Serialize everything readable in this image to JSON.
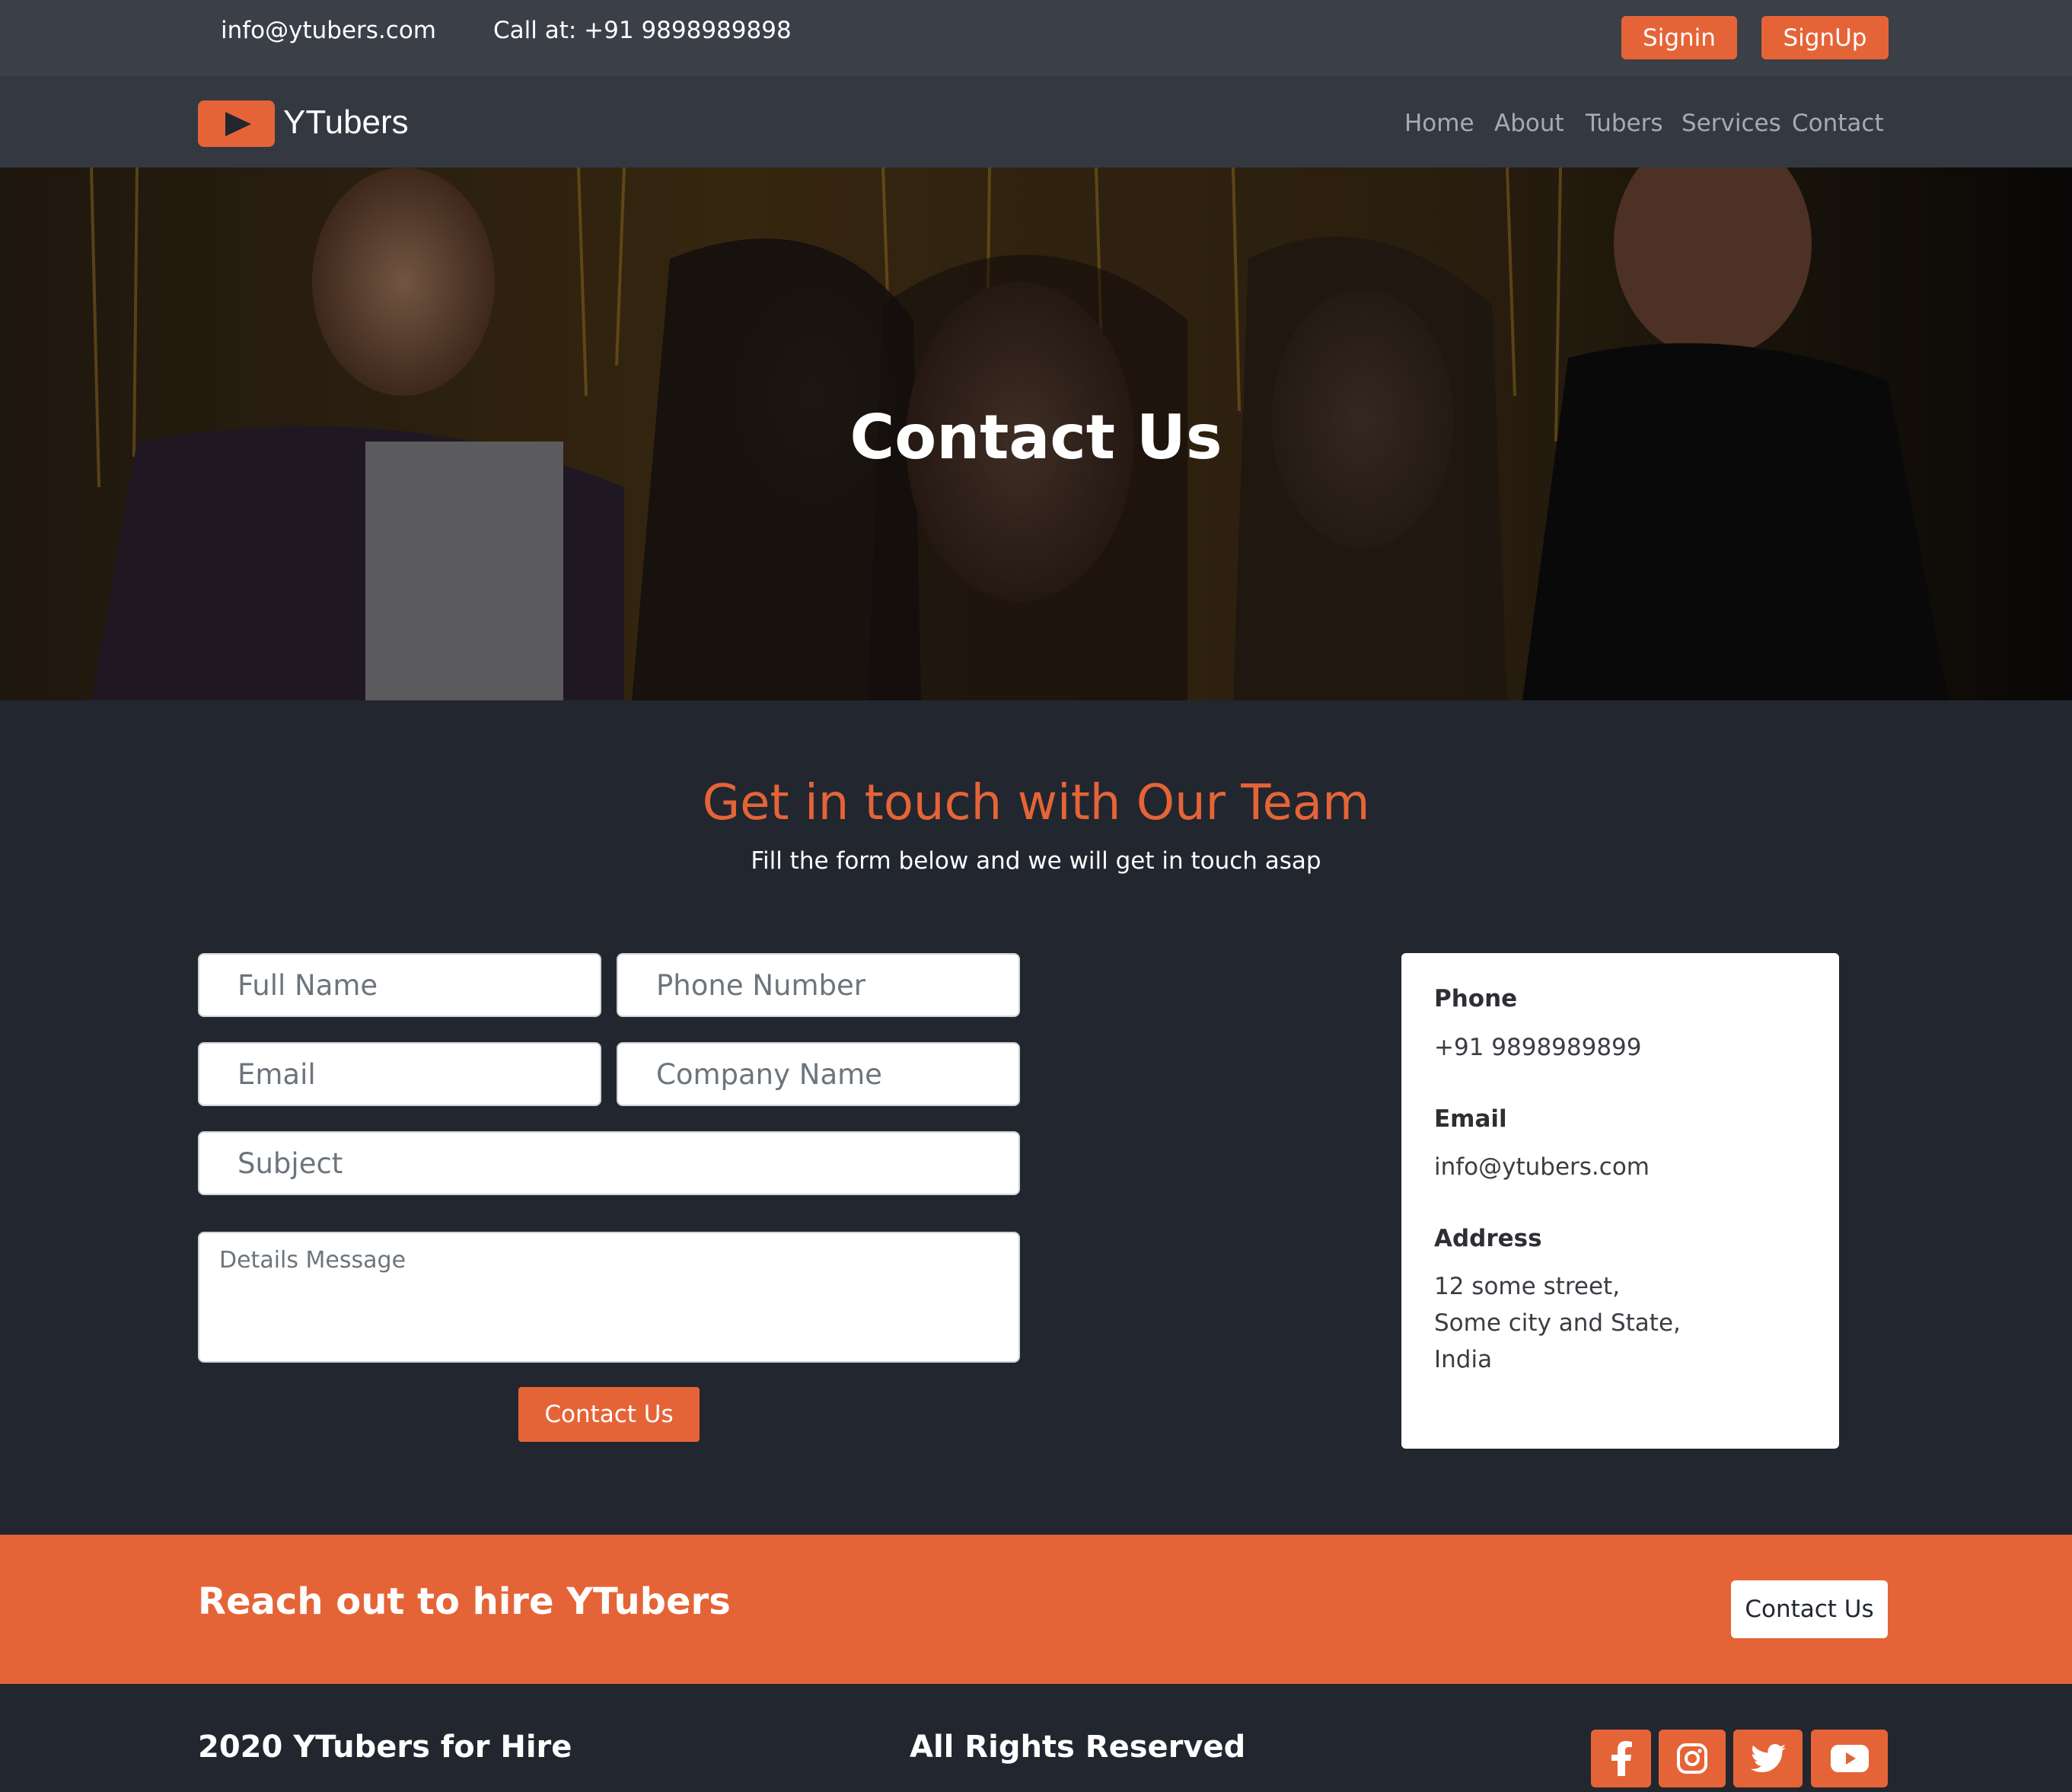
{
  "topbar": {
    "email": "info@ytubers.com",
    "phone": "Call at: +91 9898989898",
    "signin_label": "Signin",
    "signup_label": "SignUp"
  },
  "navbar": {
    "brand": "YTubers",
    "links": [
      "Home",
      "About",
      "Tubers",
      "Services",
      "Contact"
    ]
  },
  "hero": {
    "title": "Contact Us"
  },
  "contact": {
    "title": "Get in touch with Our Team",
    "subtitle": "Fill the form below and we will get in touch asap",
    "fields": {
      "full_name": "Full Name",
      "phone": "Phone Number",
      "email": "Email",
      "company": "Company Name",
      "subject": "Subject",
      "message": "Details Message"
    },
    "submit_label": "Contact Us"
  },
  "info_card": {
    "phone_label": "Phone",
    "phone_value": "+91 9898989899",
    "email_label": "Email",
    "email_value": "info@ytubers.com",
    "address_label": "Address",
    "address_lines": [
      "12 some street,",
      "Some city and State,",
      "India"
    ]
  },
  "cta": {
    "text": "Reach out to hire YTubers",
    "button_label": "Contact Us"
  },
  "footer": {
    "left": "2020 YTubers for Hire",
    "middle": "All Rights Reserved",
    "social_icons": [
      "facebook-icon",
      "instagram-icon",
      "twitter-icon",
      "youtube-icon"
    ]
  },
  "colors": {
    "accent": "#e56437",
    "background": "#22262f",
    "topbar": "#3a3f48",
    "navbar": "#343941"
  }
}
